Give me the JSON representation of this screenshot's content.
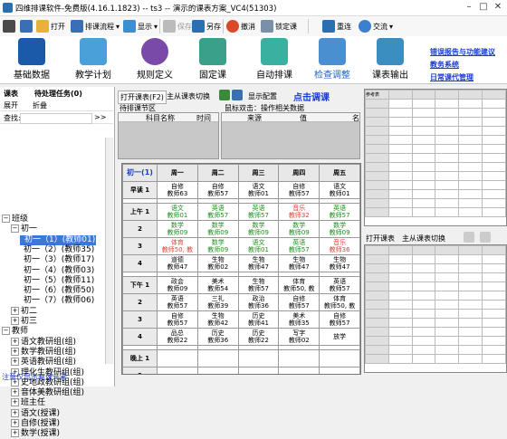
{
  "window": {
    "title": "四维排课软件-免费版(4.16.1.1823) -- ts3 -- 演示的课表方案_VC4(51303)"
  },
  "toolbar": {
    "open": "打开",
    "sort": "排课流程",
    "show": "显示",
    "save": "保存",
    "saveas": "另存",
    "undo": "撤消",
    "lock": "锁定课",
    "reconnect": "重连",
    "exchange": "交流"
  },
  "ribbon": {
    "items": [
      "基础数据",
      "教学计划",
      "规则定义",
      "固定课",
      "自动排课",
      "检查调整",
      "课表输出"
    ],
    "links": [
      "错误报告与功能建议",
      "教务系统",
      "日常课代管理"
    ]
  },
  "left": {
    "tab1": "课表",
    "tab2": "待处理任务(0)",
    "expand": "展开",
    "collapse": "折叠",
    "search_label": "查找:",
    "search_btn": ">>",
    "tree": [
      {
        "t": "班级",
        "lvl": 0,
        "exp": "−"
      },
      {
        "t": "初一",
        "lvl": 1,
        "exp": "−"
      },
      {
        "t": "初一（1）(教师01)",
        "lvl": 2,
        "sel": true
      },
      {
        "t": "初一（2）(教师35)",
        "lvl": 2
      },
      {
        "t": "初一（3）(教师17)",
        "lvl": 2
      },
      {
        "t": "初一（4）(教师03)",
        "lvl": 2
      },
      {
        "t": "初一（5）(教师11)",
        "lvl": 2
      },
      {
        "t": "初一（6）(教师50)",
        "lvl": 2
      },
      {
        "t": "初一（7）(教师06)",
        "lvl": 2
      },
      {
        "t": "初二",
        "lvl": 1,
        "exp": "+"
      },
      {
        "t": "初三",
        "lvl": 1,
        "exp": "+"
      },
      {
        "t": "教师",
        "lvl": 0,
        "exp": "−"
      },
      {
        "t": "语文教研组(组)",
        "lvl": 1,
        "exp": "+"
      },
      {
        "t": "数学教研组(组)",
        "lvl": 1,
        "exp": "+"
      },
      {
        "t": "英语教研组(组)",
        "lvl": 1,
        "exp": "+"
      },
      {
        "t": "理化生教研组(组)",
        "lvl": 1,
        "exp": "+"
      },
      {
        "t": "史地政教研组(组)",
        "lvl": 1,
        "exp": "+"
      },
      {
        "t": "音体美教研组(组)",
        "lvl": 1,
        "exp": "+"
      },
      {
        "t": "班主任",
        "lvl": 1,
        "exp": "+"
      },
      {
        "t": "语文(授课)",
        "lvl": 1,
        "exp": "+"
      },
      {
        "t": "自修(授课)",
        "lvl": 1,
        "exp": "+"
      },
      {
        "t": "数学(授课)",
        "lvl": 1,
        "exp": "+"
      }
    ],
    "footer": "注意仅显示有课元素"
  },
  "center": {
    "btn_open": "打开课表(F2)",
    "btn_switch": "主从课表切换",
    "btn_config": "显示配置",
    "btn_adjust": "点击调课",
    "pending_label": "待排课节区",
    "pending_cols": [
      "科目名称",
      "时间"
    ],
    "hint": "鼠标双击：操作相关数据",
    "hint_cols": [
      "来源",
      "值",
      "名"
    ],
    "grid_title": "初一(1)",
    "days": [
      "周一",
      "周二",
      "周三",
      "周四",
      "周五"
    ],
    "rows": [
      {
        "label": "早读 1",
        "cells": [
          [
            "自修",
            "教师63"
          ],
          [
            "自修",
            "教师57"
          ],
          [
            "语文",
            "教师01"
          ],
          [
            "自修",
            "教师57"
          ],
          [
            "语文",
            "教师01"
          ]
        ]
      },
      {
        "gap": true
      },
      {
        "label": "上午 1",
        "cells": [
          [
            "语文",
            "教师01"
          ],
          [
            "英语",
            "教师57"
          ],
          [
            "英语",
            "教师57"
          ],
          [
            "音乐",
            "教师32"
          ],
          [
            "英语",
            "教师57"
          ]
        ]
      },
      {
        "label": "2",
        "cells": [
          [
            "数学",
            "教师09"
          ],
          [
            "数学",
            "教师09"
          ],
          [
            "数学",
            "教师09"
          ],
          [
            "数学",
            "教师09"
          ],
          [
            "数学",
            "教师09"
          ]
        ]
      },
      {
        "label": "3",
        "cells": [
          [
            "体育",
            "教师50, 教"
          ],
          [
            "数学",
            "教师09"
          ],
          [
            "语文",
            "教师01"
          ],
          [
            "英语",
            "教师57"
          ],
          [
            "音乐",
            "教师36"
          ]
        ]
      },
      {
        "label": "4",
        "cells": [
          [
            "道德",
            "教师47"
          ],
          [
            "生物",
            "教师02"
          ],
          [
            "生物",
            "教师47"
          ],
          [
            "生物",
            "教师47"
          ],
          [
            "生物",
            "教师47"
          ]
        ]
      },
      {
        "gap": true
      },
      {
        "label": "下午 1",
        "cells": [
          [
            "政会",
            "教师09"
          ],
          [
            "美术",
            "教师54"
          ],
          [
            "生物",
            "教师57"
          ],
          [
            "体育",
            "教师50, 教"
          ],
          [
            "英语",
            "教师57"
          ]
        ]
      },
      {
        "label": "2",
        "cells": [
          [
            "英语",
            "教师57"
          ],
          [
            "三礼",
            "教师39"
          ],
          [
            "政治",
            "教师36"
          ],
          [
            "自修",
            "教师57"
          ],
          [
            "体育",
            "教师50, 教"
          ]
        ]
      },
      {
        "label": "3",
        "cells": [
          [
            "自修",
            "教师57"
          ],
          [
            "生物",
            "教师42"
          ],
          [
            "历史",
            "教师41"
          ],
          [
            "美术",
            "教师35"
          ],
          [
            "自修",
            "教师57"
          ]
        ]
      },
      {
        "label": "4",
        "cells": [
          [
            "品总",
            "教师22"
          ],
          [
            "历史",
            "教师36"
          ],
          [
            "历史",
            "教师22"
          ],
          [
            "写字",
            "教师02"
          ],
          [
            "放学",
            ""
          ]
        ]
      },
      {
        "gap": true
      },
      {
        "label": "晚上 1",
        "cells": [
          [
            "",
            ""
          ],
          [
            "",
            ""
          ],
          [
            "",
            ""
          ],
          [
            "",
            ""
          ],
          [
            "",
            ""
          ]
        ]
      },
      {
        "label": "2",
        "cells": [
          [
            "",
            ""
          ],
          [
            "",
            ""
          ],
          [
            "",
            ""
          ],
          [
            "",
            ""
          ],
          [
            "",
            ""
          ]
        ]
      }
    ]
  },
  "right": {
    "top_title": "参考表",
    "btn_open": "打开课表",
    "btn_switch": "主从课表切换"
  },
  "colors": {
    "accent": "#1e64c8",
    "selected": "#3b78d8",
    "green": "#1a8f1a",
    "red": "#e0403a",
    "blue": "#1a3cd0"
  }
}
